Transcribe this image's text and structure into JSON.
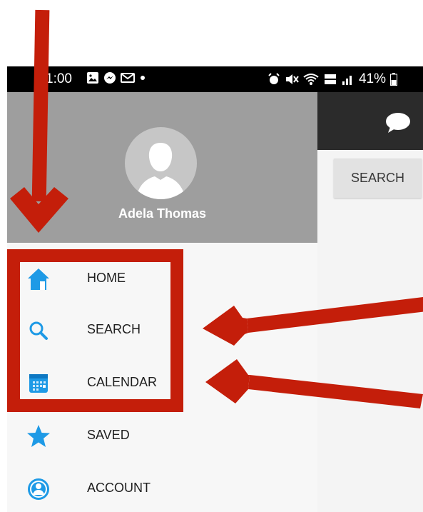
{
  "status_bar": {
    "time": "1:00",
    "battery": "41%"
  },
  "drawer": {
    "user_name": "Adela Thomas",
    "menu": [
      {
        "label": "HOME",
        "icon": "home-icon"
      },
      {
        "label": "SEARCH",
        "icon": "search-icon"
      },
      {
        "label": "CALENDAR",
        "icon": "calendar-icon"
      },
      {
        "label": "SAVED",
        "icon": "star-icon"
      },
      {
        "label": "ACCOUNT",
        "icon": "account-icon"
      }
    ]
  },
  "main": {
    "search_button_label": "SEARCH"
  },
  "colors": {
    "status_bar": "#000000",
    "drawer_header": "#9e9e9e",
    "drawer_bg": "#f7f7f7",
    "toolbar": "#2b2b2b",
    "icon_blue": "#1e9ae6",
    "annotation_red": "#c41e0a"
  }
}
